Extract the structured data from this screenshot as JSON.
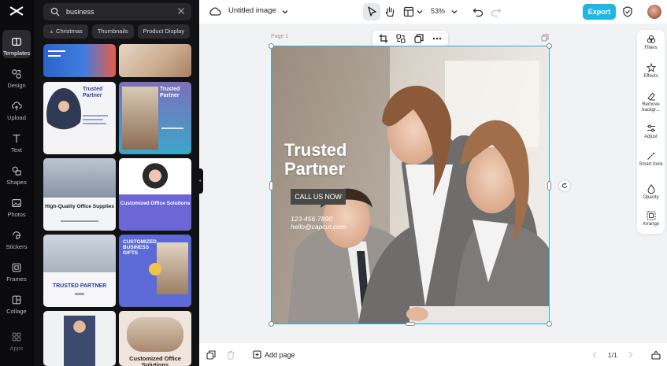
{
  "rail": {
    "items": [
      {
        "label": "Templates",
        "icon": "templates-icon"
      },
      {
        "label": "Design",
        "icon": "design-icon"
      },
      {
        "label": "Upload",
        "icon": "upload-icon"
      },
      {
        "label": "Text",
        "icon": "text-icon"
      },
      {
        "label": "Shapes",
        "icon": "shapes-icon"
      },
      {
        "label": "Photos",
        "icon": "photos-icon"
      },
      {
        "label": "Stickers",
        "icon": "stickers-icon"
      },
      {
        "label": "Frames",
        "icon": "frames-icon"
      },
      {
        "label": "Collage",
        "icon": "collage-icon"
      },
      {
        "label": "Apps",
        "icon": "apps-icon"
      }
    ]
  },
  "search": {
    "value": "business"
  },
  "chips": [
    "Christmas",
    "Thumbnails",
    "Product Display"
  ],
  "templates": [
    {
      "title": "Trusted Partner"
    },
    {
      "title": "Trusted Partner"
    },
    {
      "title": "High-Quality Office Supplies"
    },
    {
      "title": "Customized Office Solutions"
    },
    {
      "title": "TRUSTED PARTNER"
    },
    {
      "title": "CUSTOMIZED BUSINESS GIFTS"
    },
    {
      "title": ""
    },
    {
      "title": "Customized Office Solutions"
    }
  ],
  "topbar": {
    "title": "Untitled image",
    "zoom": "53%",
    "export_label": "Export"
  },
  "canvas": {
    "page_label": "Page 1",
    "title_line1": "Trusted",
    "title_line2": "Partner",
    "cta": "CALL US NOW",
    "phone": "123-456-7890",
    "email": "hello@capcut.com"
  },
  "right_panel": [
    "Filters",
    "Effects",
    "Remove backgr...",
    "Adjust",
    "Smart tools",
    "Opacity",
    "Arrange"
  ],
  "bottombar": {
    "add_page": "Add page",
    "pager": "1/1"
  },
  "colors": {
    "accent": "#1fb6e6",
    "rail_bg": "#0b0b0d",
    "panel_bg": "#121215"
  }
}
